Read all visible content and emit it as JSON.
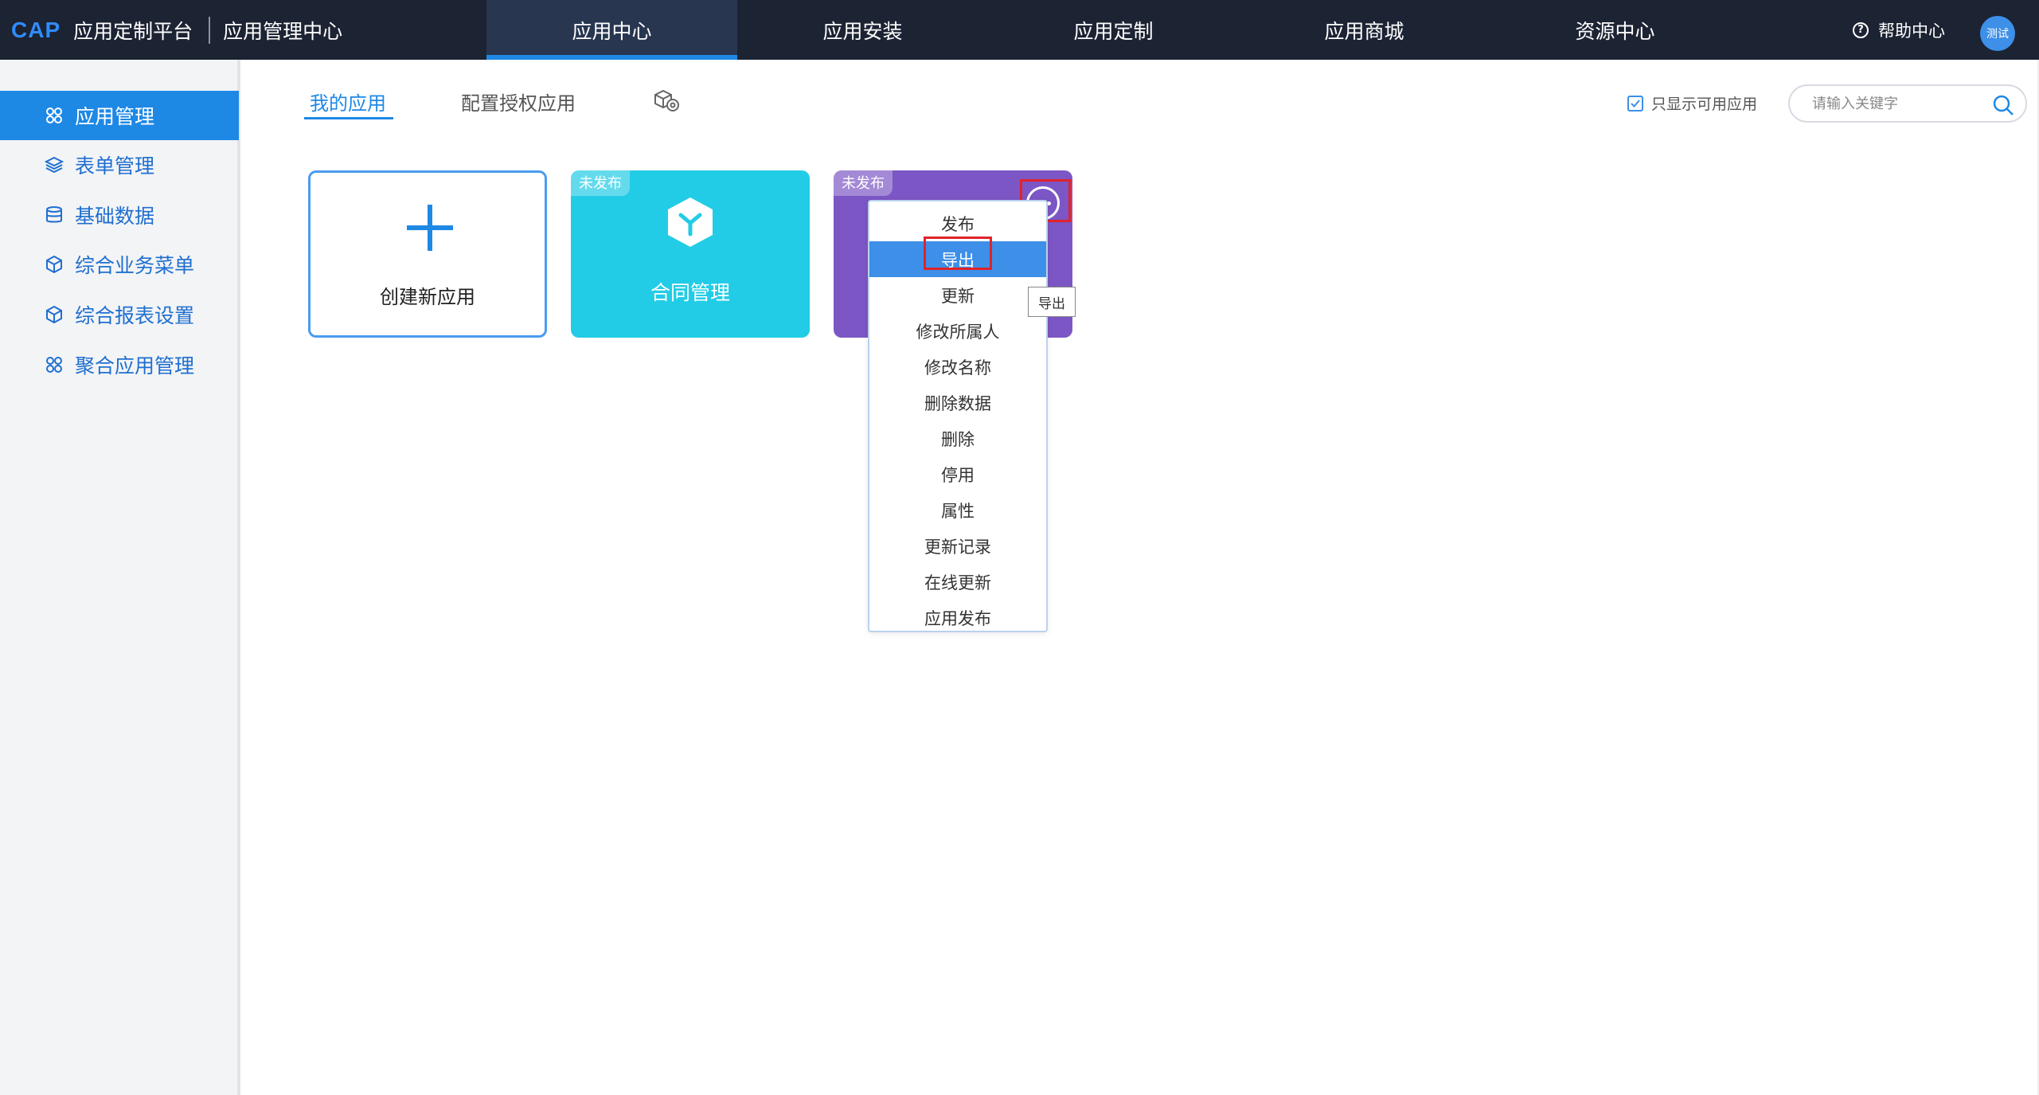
{
  "header": {
    "logo": "CAP",
    "platform": "应用定制平台",
    "center_title": "应用管理中心",
    "nav": [
      "应用中心",
      "应用安装",
      "应用定制",
      "应用商城",
      "资源中心"
    ],
    "help": "帮助中心",
    "avatar_text": "测试"
  },
  "sidebar": {
    "items": [
      {
        "label": "应用管理",
        "icon": "clover-icon"
      },
      {
        "label": "表单管理",
        "icon": "layers-icon"
      },
      {
        "label": "基础数据",
        "icon": "database-icon"
      },
      {
        "label": "综合业务菜单",
        "icon": "cube-icon"
      },
      {
        "label": "综合报表设置",
        "icon": "cube-icon"
      },
      {
        "label": "聚合应用管理",
        "icon": "clover-icon"
      }
    ]
  },
  "tabs": {
    "my_apps": "我的应用",
    "authorized_apps": "配置授权应用"
  },
  "filter": {
    "only_available": "只显示可用应用",
    "search_placeholder": "请输入关键字"
  },
  "cards": {
    "create": "创建新应用",
    "contract_badge": "未发布",
    "contract_name": "合同管理",
    "purple_badge": "未发布"
  },
  "menu": {
    "items": [
      "发布",
      "导出",
      "更新",
      "修改所属人",
      "修改名称",
      "删除数据",
      "删除",
      "停用",
      "属性",
      "更新记录",
      "在线更新",
      "应用发布"
    ],
    "tooltip": "导出"
  },
  "colors": {
    "topbar": "#1c2333",
    "accent": "#1e88e5",
    "contract_card": "#22cce6",
    "purple_card": "#7c56c4",
    "highlight": "#e0232a"
  }
}
